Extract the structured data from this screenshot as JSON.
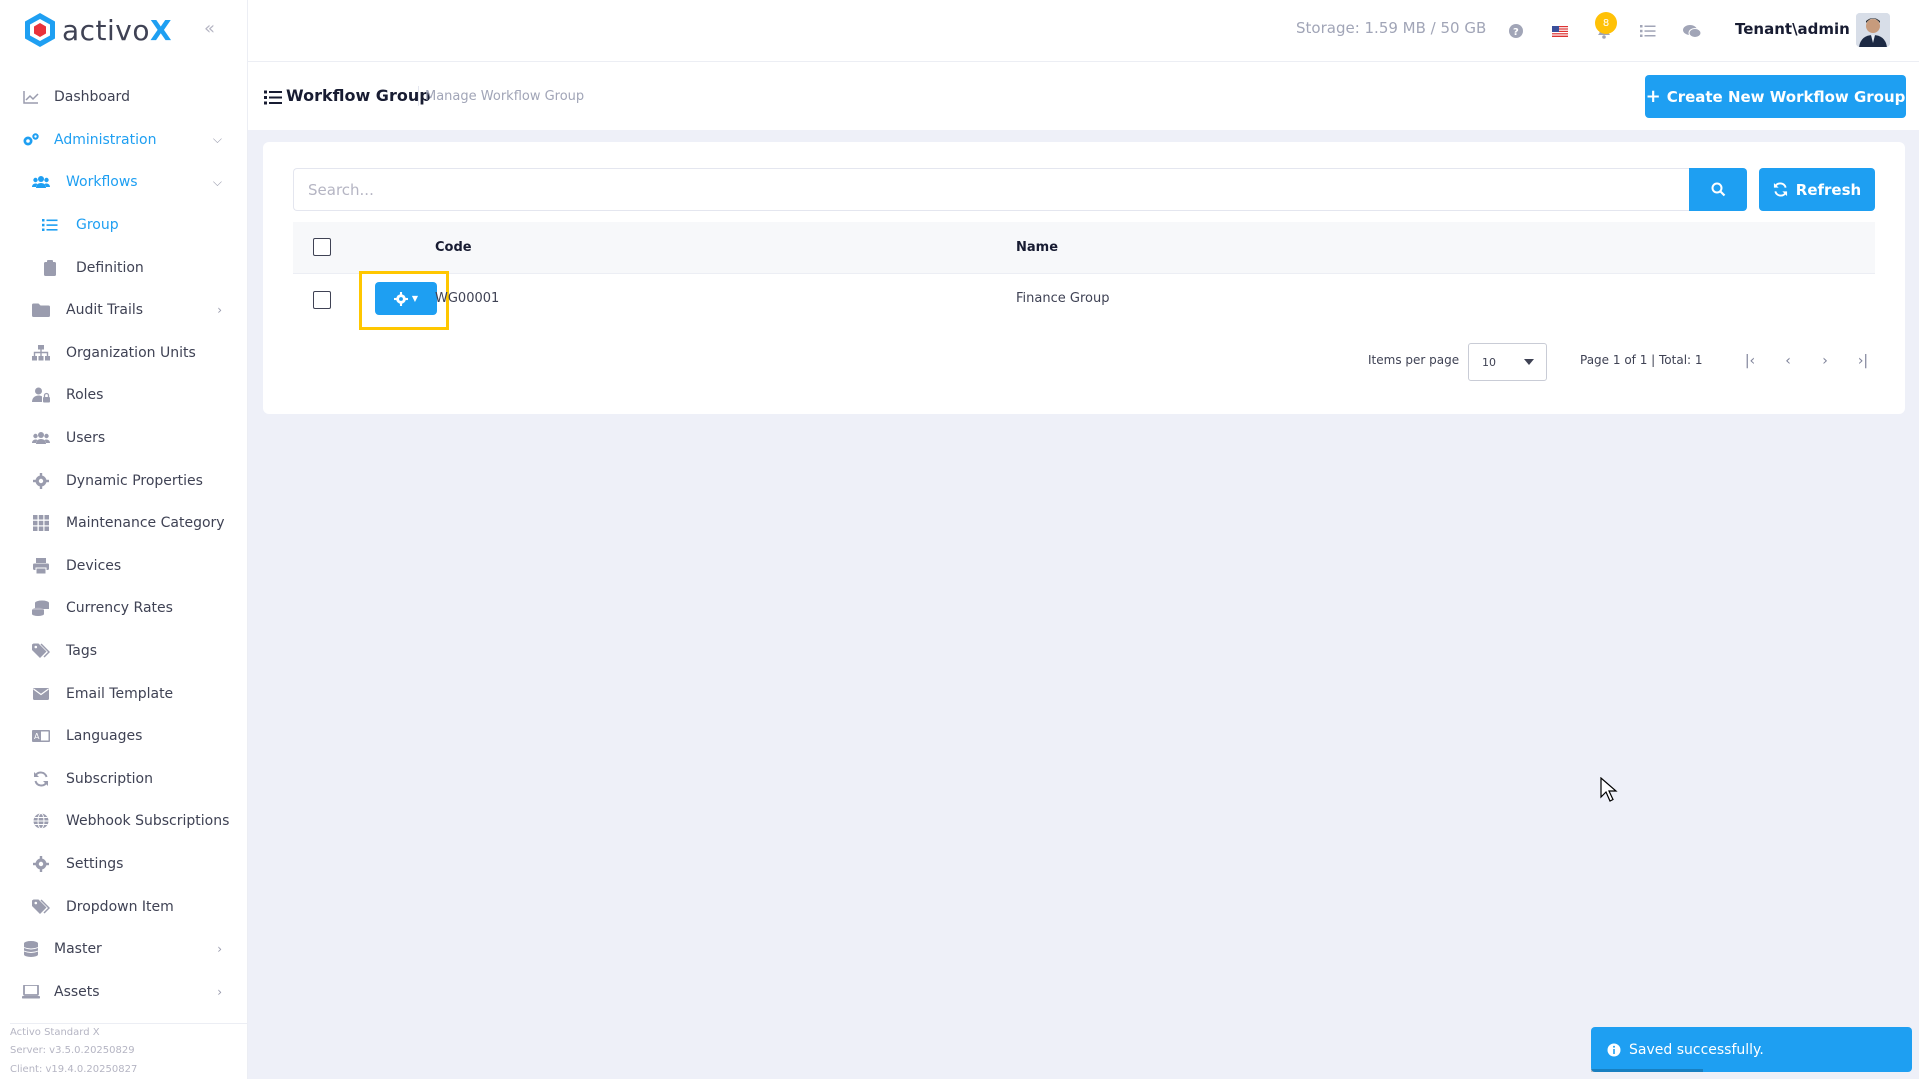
{
  "brand": {
    "name_main": "activo",
    "name_accent": "X"
  },
  "header": {
    "storage": "Storage: 1.59 MB / 50 GB",
    "notification_count": "8",
    "user": "Tenant\\admin"
  },
  "sidebar": {
    "items": [
      {
        "label": "Dashboard",
        "icon": "chart-line-icon"
      },
      {
        "label": "Administration",
        "icon": "cogs-icon"
      },
      {
        "label": "Workflows",
        "icon": "users-icon"
      },
      {
        "label": "Group",
        "icon": "list-icon"
      },
      {
        "label": "Definition",
        "icon": "clipboard-icon"
      },
      {
        "label": "Audit Trails",
        "icon": "folder-icon"
      },
      {
        "label": "Organization Units",
        "icon": "sitemap-icon"
      },
      {
        "label": "Roles",
        "icon": "user-lock-icon"
      },
      {
        "label": "Users",
        "icon": "users-icon"
      },
      {
        "label": "Dynamic Properties",
        "icon": "gear-icon"
      },
      {
        "label": "Maintenance Category",
        "icon": "grid-icon"
      },
      {
        "label": "Devices",
        "icon": "printer-icon"
      },
      {
        "label": "Currency Rates",
        "icon": "coins-icon"
      },
      {
        "label": "Tags",
        "icon": "tags-icon"
      },
      {
        "label": "Email Template",
        "icon": "envelope-icon"
      },
      {
        "label": "Languages",
        "icon": "language-icon"
      },
      {
        "label": "Subscription",
        "icon": "sync-icon"
      },
      {
        "label": "Webhook Subscriptions",
        "icon": "globe-icon"
      },
      {
        "label": "Settings",
        "icon": "gear-icon"
      },
      {
        "label": "Dropdown Item",
        "icon": "tags-icon"
      },
      {
        "label": "Master",
        "icon": "database-icon"
      },
      {
        "label": "Assets",
        "icon": "laptop-icon"
      }
    ],
    "footer": {
      "product": "Activo Standard X",
      "server": "Server: v3.5.0.20250829",
      "client": "Client: v19.4.0.20250827"
    }
  },
  "subheader": {
    "title": "Workflow Group",
    "subtitle": "Manage Workflow Group",
    "create_button": "Create New Workflow Group"
  },
  "search": {
    "placeholder": "Search..."
  },
  "toolbar": {
    "refresh": "Refresh"
  },
  "table": {
    "columns": [
      "Code",
      "Name"
    ],
    "rows": [
      {
        "code": "WG00001",
        "name": "Finance Group"
      }
    ]
  },
  "pagination": {
    "items_per_page_label": "Items per page",
    "items_per_page": "10",
    "page_info": "Page 1 of 1 | Total: 1"
  },
  "toast": {
    "message": "Saved successfully."
  },
  "colors": {
    "primary": "#1e9ff2",
    "highlight": "#ffc700",
    "badge": "#ffc107"
  }
}
